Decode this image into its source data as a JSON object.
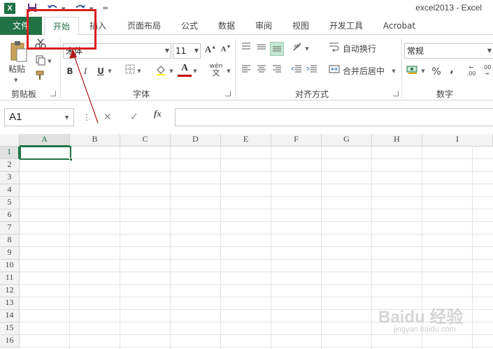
{
  "window": {
    "title": "excel2013 - Excel",
    "app_logo": "X"
  },
  "quick_access": {
    "customize": "="
  },
  "tabs": {
    "file": "文件",
    "items": [
      "开始",
      "插入",
      "页面布局",
      "公式",
      "数据",
      "审阅",
      "视图",
      "开发工具",
      "Acrobat"
    ],
    "active_index": 0
  },
  "ribbon": {
    "clipboard": {
      "paste_label": "粘贴",
      "group_label": "剪贴板"
    },
    "font": {
      "font_name": "宋体",
      "font_size": "11",
      "group_label": "字体",
      "bold": "B",
      "italic": "I",
      "underline": "U",
      "grow": "A",
      "shrink": "A",
      "font_color": "A",
      "phonetic": "wén"
    },
    "alignment": {
      "wrap_text": "自动换行",
      "merge_center": "合并后居中",
      "group_label": "对齐方式"
    },
    "number": {
      "format": "常规",
      "group_label": "数字",
      "percent": "%",
      "comma": ","
    }
  },
  "formula_bar": {
    "name_box": "A1",
    "cancel": "✕",
    "enter": "✓",
    "fx": "fx",
    "value": ""
  },
  "grid": {
    "columns": [
      "A",
      "B",
      "C",
      "D",
      "E",
      "F",
      "G",
      "H",
      "I"
    ],
    "rows": [
      "1",
      "2",
      "3",
      "4",
      "5",
      "6",
      "7",
      "8",
      "9",
      "10",
      "11",
      "12",
      "13",
      "14",
      "15",
      "16"
    ],
    "active_cell": "A1"
  },
  "annotation": {
    "color": "#d81e1e"
  },
  "watermark": {
    "main": "Baidu 经验",
    "sub": "jingyan.baidu.com"
  },
  "colors": {
    "accent": "#217346"
  }
}
